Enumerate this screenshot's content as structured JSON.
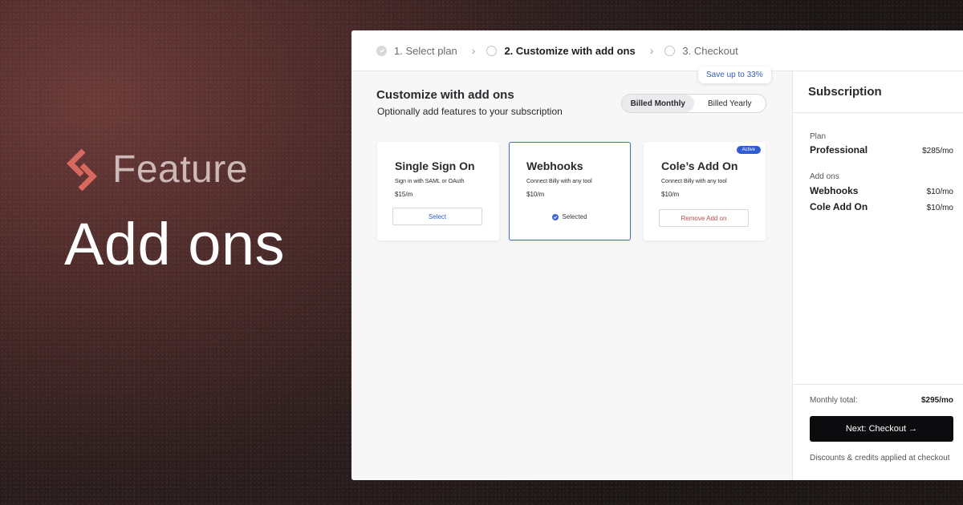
{
  "hero": {
    "brand": "Feature",
    "title": "Add ons",
    "logo_icon": "brand-s-logo-icon",
    "brand_color": "#d9695f"
  },
  "stepper": {
    "steps": [
      {
        "label": "1. Select plan",
        "state": "done"
      },
      {
        "label": "2. Customize with add ons",
        "state": "active"
      },
      {
        "label": "3. Checkout",
        "state": "pending"
      }
    ],
    "separator": "›"
  },
  "customize": {
    "title": "Customize with add ons",
    "subtitle": "Optionally add features to your subscription",
    "save_tip": "Save up to 33%",
    "billing": {
      "monthly": "Billed Monthly",
      "yearly": "Billed Yearly",
      "selected": "monthly"
    }
  },
  "cards": [
    {
      "title": "Single Sign On",
      "desc": "Sign in with SAML or OAuth",
      "price": "$15/m",
      "action": "Select",
      "state": "available"
    },
    {
      "title": "Webhooks",
      "desc": "Connect Billy with any tool",
      "price": "$10/m",
      "action": "Selected",
      "state": "selected"
    },
    {
      "title": "Cole’s Add On",
      "desc": "Connect Billy with any tool",
      "price": "$10/m",
      "action": "Remove Add on",
      "state": "active",
      "badge": "Active"
    }
  ],
  "subscription": {
    "title": "Subscription",
    "plan_label": "Plan",
    "plan": {
      "name": "Professional",
      "price": "$285/mo"
    },
    "addons_label": "Add ons",
    "addons": [
      {
        "name": "Webhooks",
        "price": "$10/mo"
      },
      {
        "name": "Cole Add On",
        "price": "$10/mo"
      }
    ],
    "total_label": "Monthly total:",
    "total": "$295/mo",
    "next_label": "Next: Checkout →",
    "note": "Discounts & credits applied at checkout"
  },
  "colors": {
    "accent": "#2f5bd6",
    "remove": "#c0504a",
    "primary_button": "#0c0c0e"
  }
}
